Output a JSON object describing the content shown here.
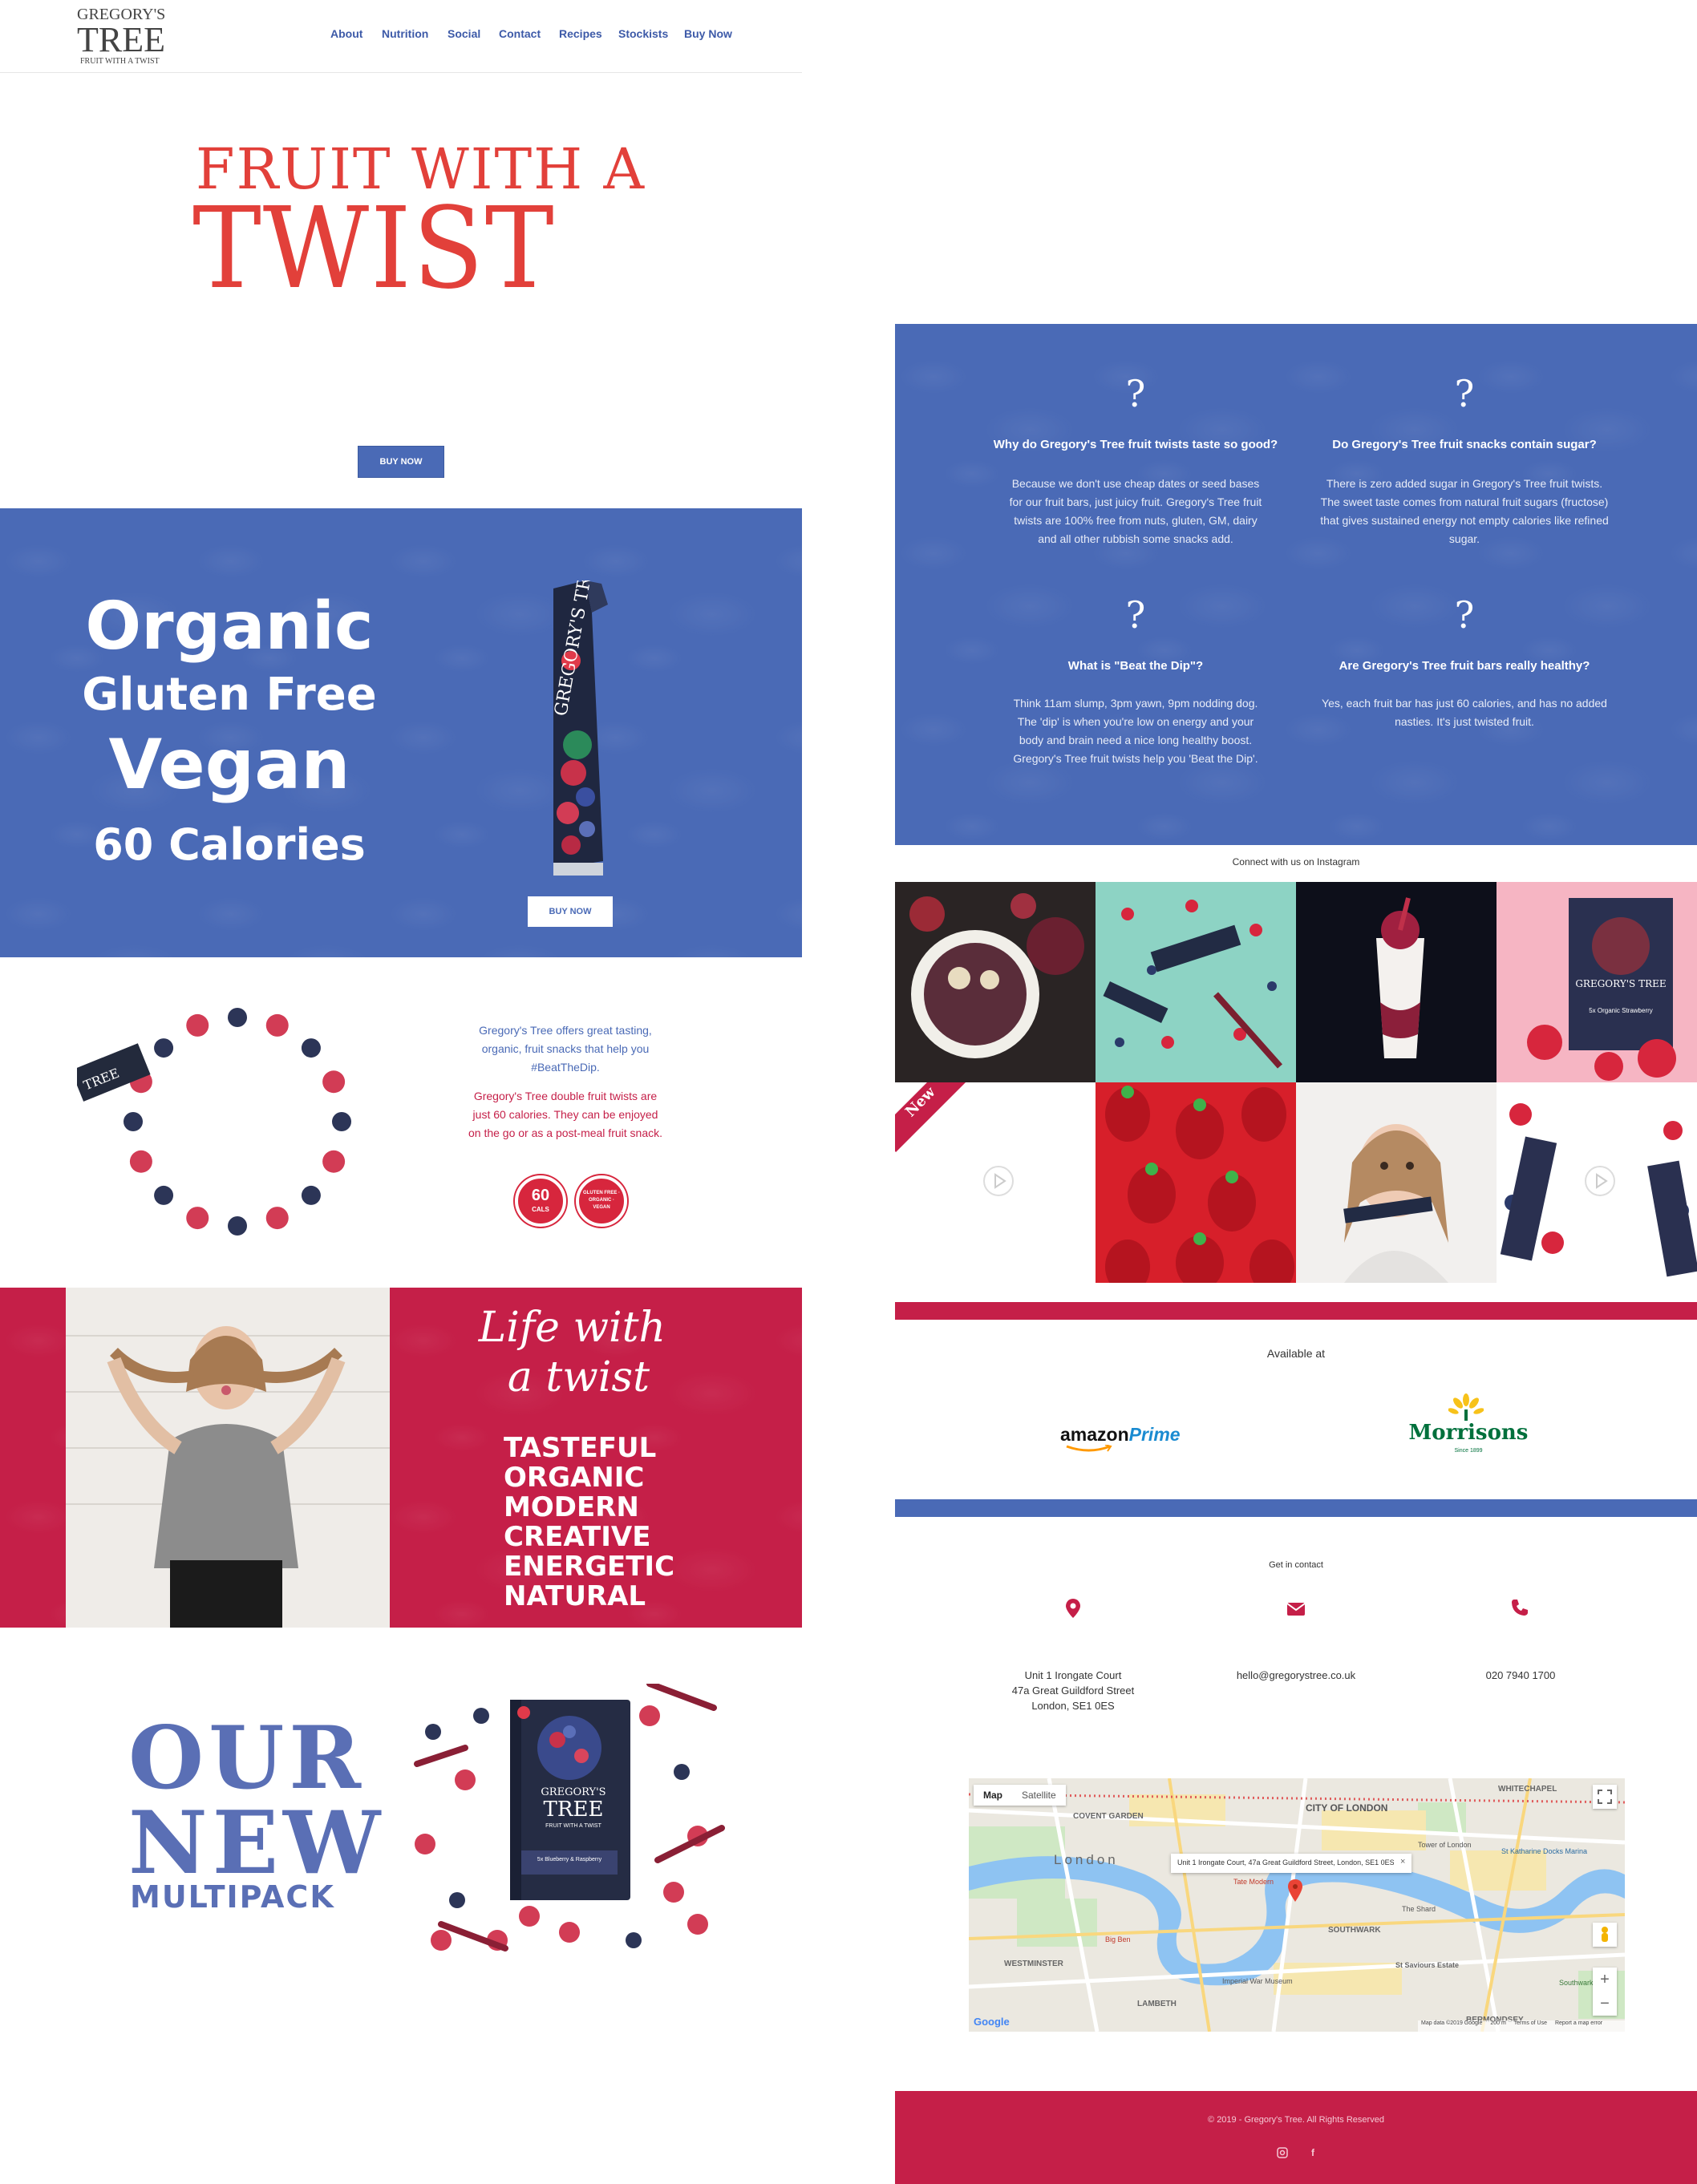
{
  "header": {
    "logo_top": "GREGORY'S",
    "logo_main": "TREE",
    "logo_tag": "FRUIT WITH A TWIST",
    "nav": [
      "About",
      "Nutrition",
      "Social",
      "Contact",
      "Recipes",
      "Stockists",
      "Buy Now"
    ]
  },
  "hero": {
    "line1": "FRUIT WITH A",
    "line2": "TWIST",
    "button": "BUY NOW"
  },
  "features": {
    "lines": [
      "Organic",
      "Gluten Free",
      "Vegan",
      "60 Calories"
    ],
    "button": "BUY NOW"
  },
  "intro": {
    "blue_text": "Gregory's Tree offers great tasting, organic, fruit snacks that help you #BeatTheDip.",
    "red_text": "Gregory's Tree double fruit twists are just 60 calories. They can be enjoyed on the go or as a post-meal fruit snack.",
    "badge1_top": "60",
    "badge1_bottom": "CALS",
    "badge2": "GLUTEN FREE · ORGANIC · VEGAN"
  },
  "life": {
    "script1": "Life with",
    "script2": "a twist",
    "words": [
      "TASTEFUL",
      "ORGANIC",
      "MODERN",
      "CREATIVE",
      "ENERGETIC",
      "NATURAL"
    ]
  },
  "multipack": {
    "line1": "OUR",
    "line2": "NEW",
    "line3": "MULTIPACK",
    "box_brand_top": "GREGORY'S",
    "box_brand": "TREE",
    "box_tag": "FRUIT WITH A TWIST",
    "box_flavor": "5x Blueberry & Raspberry"
  },
  "faq": [
    {
      "title": "Why do Gregory's Tree fruit twists taste so good?",
      "body": "Because we don't use cheap dates or seed bases for our fruit bars, just juicy fruit. Gregory's Tree fruit twists are 100% free from nuts, gluten, GM, dairy and all other rubbish some snacks add."
    },
    {
      "title": "Do Gregory's Tree fruit snacks contain sugar?",
      "body": "There is zero added sugar in Gregory's Tree fruit twists. The sweet taste comes from natural fruit sugars (fructose) that gives sustained energy not empty calories like refined sugar."
    },
    {
      "title": "What is \"Beat the Dip\"?",
      "body": "Think 11am slump, 3pm yawn, 9pm nodding dog. The 'dip' is when you're low on energy and your body and brain need a nice long healthy boost. Gregory's Tree fruit twists help you 'Beat the Dip'."
    },
    {
      "title": "Are Gregory's Tree fruit bars really healthy?",
      "body": "Yes, each fruit bar has just 60 calories, and has no added nasties. It's just twisted fruit."
    }
  ],
  "instagram": {
    "heading": "Connect with us on Instagram",
    "new_label": "New",
    "box_brand": "GREGORY'S TREE",
    "box_flavor": "5x Organic Strawberry"
  },
  "stockists": {
    "heading": "Available at",
    "amazon": "amazon",
    "amazon_prime": "Prime",
    "morrisons": "Morrisons",
    "morrisons_since": "Since 1899"
  },
  "contact": {
    "heading": "Get in contact",
    "address": [
      "Unit 1 Irongate Court",
      "47a Great Guildford Street",
      "London, SE1 0ES"
    ],
    "email": "hello@gregorystree.co.uk",
    "phone": "020 7940 1700"
  },
  "map": {
    "tab_map": "Map",
    "tab_satellite": "Satellite",
    "info": "Unit 1 Irongate Court, 47a Great Guildford Street, London, SE1 0ES",
    "labels": [
      "CITY OF LONDON",
      "London",
      "WESTMINSTER",
      "LAMBETH",
      "SOUTHWARK",
      "BERMONDSEY",
      "COVENT GARDEN",
      "WHITECHAPEL",
      "Tate Modern",
      "The Shard",
      "Tower of London",
      "Big Ben",
      "Imperial War Museum",
      "St Saviours Estate",
      "Southwark Park",
      "St Katharine Docks Marina"
    ],
    "google": "Google",
    "attribution": "Map data ©2019 Google",
    "scale": "200 m",
    "terms": "Terms of Use",
    "report": "Report a map error",
    "zoom_in": "+",
    "zoom_out": "−"
  },
  "footer": {
    "copyright": "© 2019 - Gregory's Tree. All Rights Reserved",
    "instagram_icon": "instagram-icon",
    "facebook_icon": "facebook-icon"
  },
  "colors": {
    "blue": "#4a6ab6",
    "crimson": "#c51f48",
    "hero_red": "#e2403a",
    "multipack_blue": "#5a6fb5"
  }
}
